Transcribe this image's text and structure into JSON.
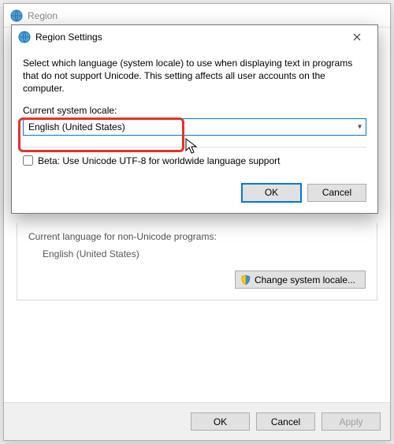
{
  "parentWindow": {
    "title": "Region",
    "nonUnicodeLabel": "Current language for non-Unicode programs:",
    "nonUnicodeValue": "English (United States)",
    "changeLocaleBtn": "Change system locale...",
    "buttons": {
      "ok": "OK",
      "cancel": "Cancel",
      "apply": "Apply"
    }
  },
  "modal": {
    "title": "Region Settings",
    "description": "Select which language (system locale) to use when displaying text in programs that do not support Unicode. This setting affects all user accounts on the computer.",
    "localeLabel": "Current system locale:",
    "localeValue": "English (United States)",
    "betaCheckbox": "Beta: Use Unicode UTF-8 for worldwide language support",
    "buttons": {
      "ok": "OK",
      "cancel": "Cancel"
    }
  }
}
